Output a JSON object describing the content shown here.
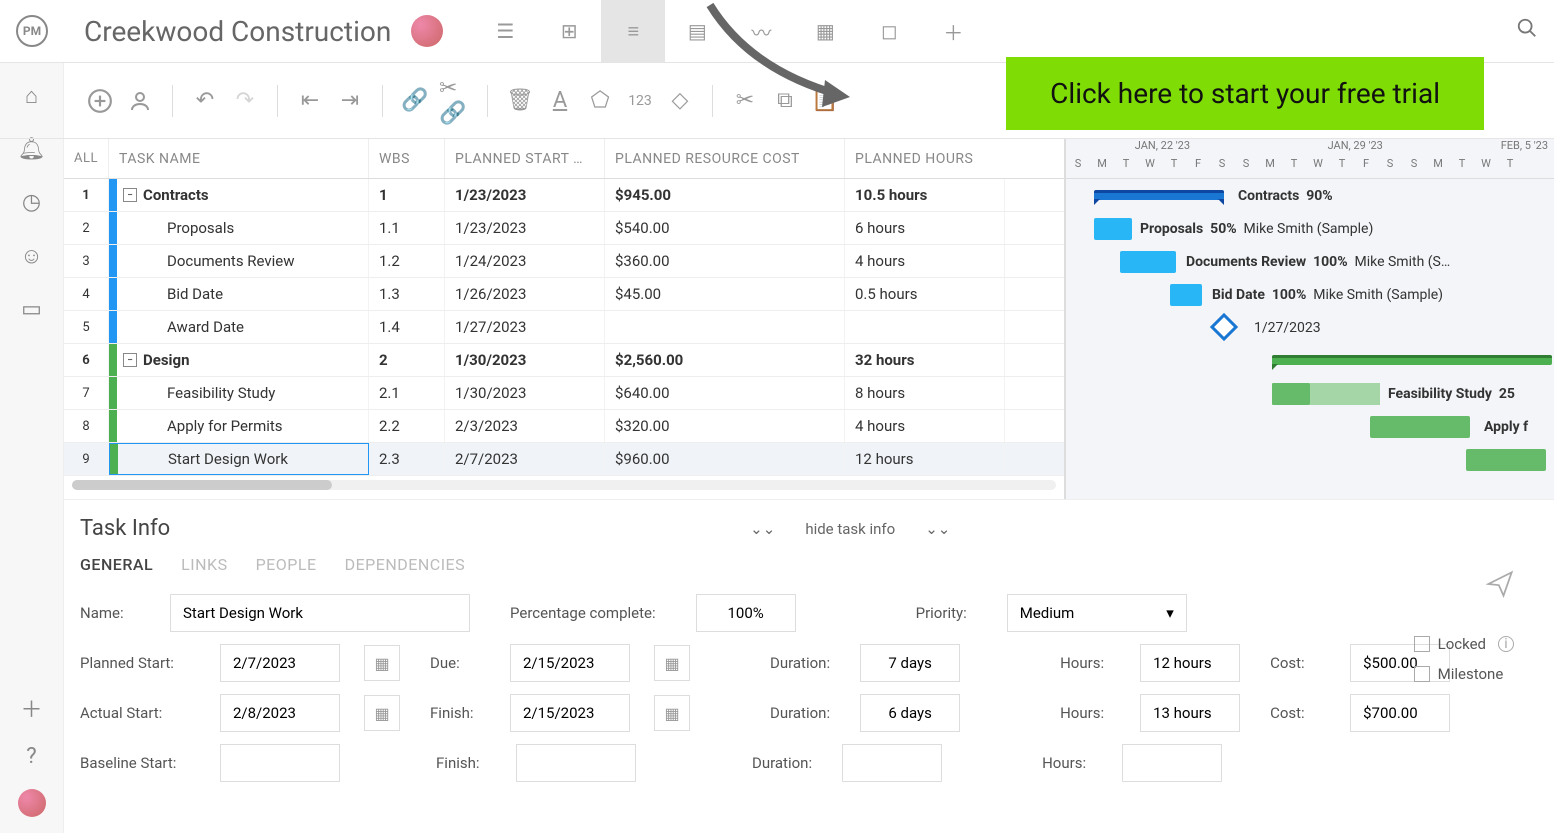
{
  "header": {
    "logo_text": "PM",
    "project_title": "Creekwood Construction"
  },
  "cta": "Click here to start your free trial",
  "columns": {
    "all": "ALL",
    "task_name": "TASK NAME",
    "wbs": "WBS",
    "planned_start": "PLANNED START …",
    "planned_cost": "PLANNED RESOURCE COST",
    "planned_hours": "PLANNED HOURS"
  },
  "rows": [
    {
      "num": "1",
      "group": true,
      "color": "blue",
      "name": "Contracts",
      "wbs": "1",
      "start": "1/23/2023",
      "cost": "$945.00",
      "hours": "10.5 hours"
    },
    {
      "num": "2",
      "group": false,
      "color": "blue",
      "name": "Proposals",
      "wbs": "1.1",
      "start": "1/23/2023",
      "cost": "$540.00",
      "hours": "6 hours"
    },
    {
      "num": "3",
      "group": false,
      "color": "blue",
      "name": "Documents Review",
      "wbs": "1.2",
      "start": "1/24/2023",
      "cost": "$360.00",
      "hours": "4 hours"
    },
    {
      "num": "4",
      "group": false,
      "color": "blue",
      "name": "Bid Date",
      "wbs": "1.3",
      "start": "1/26/2023",
      "cost": "$45.00",
      "hours": "0.5 hours"
    },
    {
      "num": "5",
      "group": false,
      "color": "blue",
      "name": "Award Date",
      "wbs": "1.4",
      "start": "1/27/2023",
      "cost": "",
      "hours": ""
    },
    {
      "num": "6",
      "group": true,
      "color": "green",
      "name": "Design",
      "wbs": "2",
      "start": "1/30/2023",
      "cost": "$2,560.00",
      "hours": "32 hours"
    },
    {
      "num": "7",
      "group": false,
      "color": "green",
      "name": "Feasibility Study",
      "wbs": "2.1",
      "start": "1/30/2023",
      "cost": "$640.00",
      "hours": "8 hours"
    },
    {
      "num": "8",
      "group": false,
      "color": "green",
      "name": "Apply for Permits",
      "wbs": "2.2",
      "start": "2/3/2023",
      "cost": "$320.00",
      "hours": "4 hours"
    },
    {
      "num": "9",
      "group": false,
      "color": "green",
      "name": "Start Design Work",
      "wbs": "2.3",
      "start": "2/7/2023",
      "cost": "$960.00",
      "hours": "12 hours",
      "selected": true
    }
  ],
  "gantt": {
    "months": [
      "JAN, 22 '23",
      "JAN, 29 '23",
      "FEB, 5 '23"
    ],
    "days": [
      "S",
      "M",
      "T",
      "W",
      "T",
      "F",
      "S",
      "S",
      "M",
      "T",
      "W",
      "T",
      "F",
      "S",
      "S",
      "M",
      "T",
      "W",
      "T"
    ],
    "bars": [
      {
        "label": "Contracts",
        "pct": "90%",
        "assignee": ""
      },
      {
        "label": "Proposals",
        "pct": "50%",
        "assignee": "Mike Smith (Sample)"
      },
      {
        "label": "Documents Review",
        "pct": "100%",
        "assignee": "Mike Smith (S…"
      },
      {
        "label": "Bid Date",
        "pct": "100%",
        "assignee": "Mike Smith (Sample)"
      },
      {
        "label_date": "1/27/2023"
      },
      {
        "label": "Feasibility Study",
        "pct": "25",
        "assignee": ""
      },
      {
        "label": "Apply f",
        "pct": "",
        "assignee": ""
      }
    ]
  },
  "task_info": {
    "title": "Task Info",
    "hide_label": "hide task info",
    "tabs": [
      "GENERAL",
      "LINKS",
      "PEOPLE",
      "DEPENDENCIES"
    ],
    "labels": {
      "name": "Name:",
      "pct": "Percentage complete:",
      "priority": "Priority:",
      "planned_start": "Planned Start:",
      "due": "Due:",
      "duration": "Duration:",
      "hours": "Hours:",
      "cost": "Cost:",
      "actual_start": "Actual Start:",
      "finish": "Finish:",
      "baseline_start": "Baseline Start:",
      "locked": "Locked",
      "milestone": "Milestone"
    },
    "values": {
      "name": "Start Design Work",
      "pct": "100%",
      "priority": "Medium",
      "planned_start": "2/7/2023",
      "due": "2/15/2023",
      "duration1": "7 days",
      "hours1": "12 hours",
      "cost1": "$500.00",
      "actual_start": "2/8/2023",
      "finish": "2/15/2023",
      "duration2": "6 days",
      "hours2": "13 hours",
      "cost2": "$700.00",
      "baseline_start": "",
      "baseline_finish": "",
      "duration3": "",
      "hours3": ""
    }
  }
}
